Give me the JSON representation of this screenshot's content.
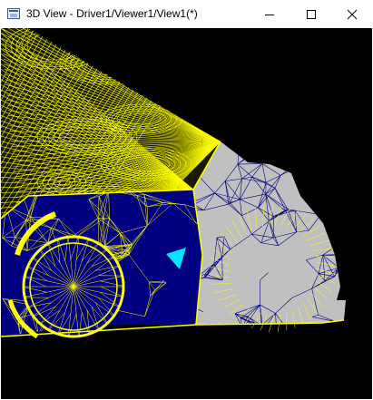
{
  "window": {
    "title": "3D View - Driver1/Viewer1/View1(*)",
    "controls": {
      "minimize": "minimize-icon",
      "maximize": "maximize-icon",
      "close": "close-icon"
    }
  },
  "viewport": {
    "background": "#000000",
    "colors": {
      "wireframe_edges": "#ffff00",
      "faces": "#000080",
      "mesh_gray": "#c0c0c0",
      "selected_face": "#00e5ff"
    }
  }
}
